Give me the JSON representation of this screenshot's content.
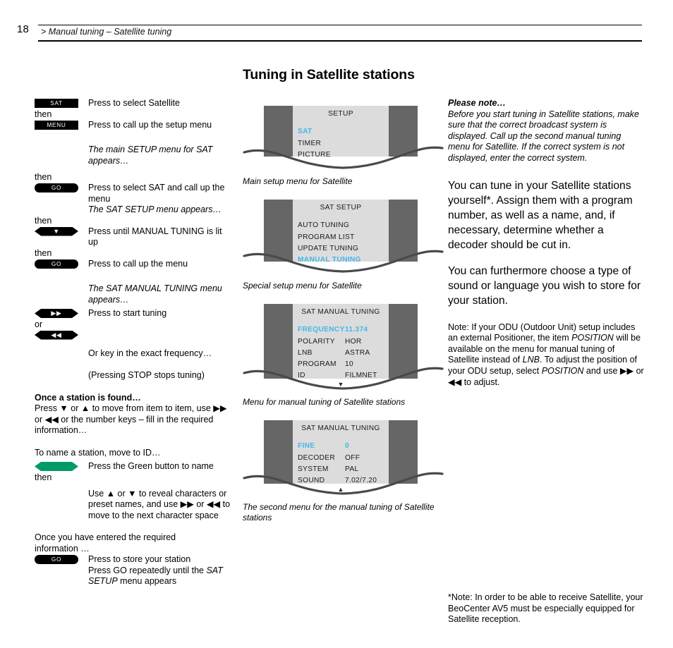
{
  "header": {
    "page_number": "18",
    "breadcrumb": "> Manual tuning – Satellite tuning"
  },
  "page_title": "Tuning in Satellite stations",
  "left_column": {
    "then_label": "then",
    "or_label": "or",
    "steps": [
      {
        "key": "SAT",
        "key_style": "rect",
        "text": "Press to select Satellite"
      },
      {
        "key": "MENU",
        "key_style": "rect",
        "text": "Press to call up the setup menu"
      },
      {
        "key": "GO",
        "key_style": "pill",
        "text": "Press to select SAT and call up the menu"
      },
      {
        "key": "▼",
        "key_style": "hex",
        "text": "Press until MANUAL TUNING is lit up"
      },
      {
        "key": "GO",
        "key_style": "pill",
        "text": "Press to call up the menu"
      },
      {
        "key": "▶▶",
        "key_style": "hex",
        "text": "Press to start tuning"
      },
      {
        "key": "◀◀",
        "key_style": "hex",
        "text": ""
      },
      {
        "key": "",
        "key_style": "green",
        "text": "Press the Green button to name"
      },
      {
        "key": "GO",
        "key_style": "pill",
        "text": "Press to store your station"
      }
    ],
    "italic_note_1": "The main SETUP menu for SAT appears…",
    "menu_appears_1": "The SAT SETUP menu appears…",
    "italic_note_2": "The SAT MANUAL TUNING menu appears…",
    "exact_frequency": "Or key in the exact frequency…",
    "stop_note": "(Pressing STOP stops tuning)",
    "found_heading": "Once a station is found…",
    "found_body_1": "Press ▼ or ▲ to move from item to item, use ▶▶",
    "found_body_2": "or ◀◀ or the number keys – fill in the required",
    "found_body_3": "information…",
    "name_station": "To name a station, move to ID…",
    "characters_1": "Use ▲ or ▼ to reveal characters or",
    "characters_2": "preset names, and use ▶▶ or ◀◀ to",
    "characters_3": "move to the next character space",
    "entered_1": "Once you have entered the required",
    "entered_2": "information …",
    "store_2a": "Press GO repeatedly until the ",
    "store_2b": "SAT SETUP",
    "store_2c": " menu appears"
  },
  "screens": [
    {
      "title": "SETUP",
      "items": [
        {
          "label": "SAT",
          "value": "",
          "selected": true
        },
        {
          "label": "TIMER",
          "value": "",
          "selected": false
        },
        {
          "label": "PICTURE",
          "value": "",
          "selected": false
        }
      ],
      "arrow": "",
      "caption": "Main setup  menu for Satellite"
    },
    {
      "title": "SAT SETUP",
      "items": [
        {
          "label": "AUTO TUNING",
          "value": "",
          "selected": false
        },
        {
          "label": "PROGRAM LIST",
          "value": "",
          "selected": false
        },
        {
          "label": "UPDATE TUNING",
          "value": "",
          "selected": false
        },
        {
          "label": "MANUAL TUNING",
          "value": "",
          "selected": true
        }
      ],
      "arrow": "",
      "caption": "Special setup menu for Satellite"
    },
    {
      "title": "SAT MANUAL TUNING",
      "items": [
        {
          "label": "FREQUENCY",
          "value": "11.374",
          "selected": true
        },
        {
          "label": "POLARITY",
          "value": "HOR",
          "selected": false
        },
        {
          "label": "LNB",
          "value": "ASTRA",
          "selected": false
        },
        {
          "label": "PROGRAM",
          "value": "10",
          "selected": false
        },
        {
          "label": "ID",
          "value": "FILMNET",
          "selected": false
        }
      ],
      "arrow": "▼",
      "caption": "Menu for manual tuning of Satellite stations"
    },
    {
      "title": "SAT MANUAL TUNING",
      "items": [
        {
          "label": "FINE",
          "value": "0",
          "selected": true
        },
        {
          "label": "DECODER",
          "value": "OFF",
          "selected": false
        },
        {
          "label": "SYSTEM",
          "value": "PAL",
          "selected": false
        },
        {
          "label": "SOUND",
          "value": "7.02/7.20",
          "selected": false
        }
      ],
      "arrow": "▲",
      "caption": "The second menu for the manual tuning of Satellite stations"
    }
  ],
  "right_column": {
    "please_note_heading": "Please note…",
    "please_note_body": "Before you start tuning in Satellite stations, make sure that the correct broadcast system is displayed. Call up the second manual tuning menu for Satellite. If the correct system is not displayed, enter the correct system.",
    "body_1": "You can tune in your Satellite stations yourself*. Assign them with a program number, as well as a name, and, if necessary, determine whether a decoder should be cut in.",
    "body_2": "You can furthermore choose a type of sound or language you wish to store for your station.",
    "odu_note_a": "Note: If your ODU (Outdoor Unit) setup includes an external Positioner, the item ",
    "odu_note_b": "POSITION",
    "odu_note_c": " will be available on the menu for manual tuning of Satellite instead of ",
    "odu_note_d": "LNB",
    "odu_note_e": ". To adjust the position of your ODU setup, select ",
    "odu_note_f": "POSITION",
    "odu_note_g": " and use ▶▶ or ◀◀  to adjust."
  },
  "footnote": "*Note: In order to be able to receive Satellite, your BeoCenter AV5 must be especially equipped for Satellite reception.",
  "colors": {
    "screen_bezel": "#666666",
    "screen_body": "#dcdcdc",
    "highlight_blue": "#45b6e8",
    "green_button": "#009b68",
    "key_black": "#000000"
  }
}
